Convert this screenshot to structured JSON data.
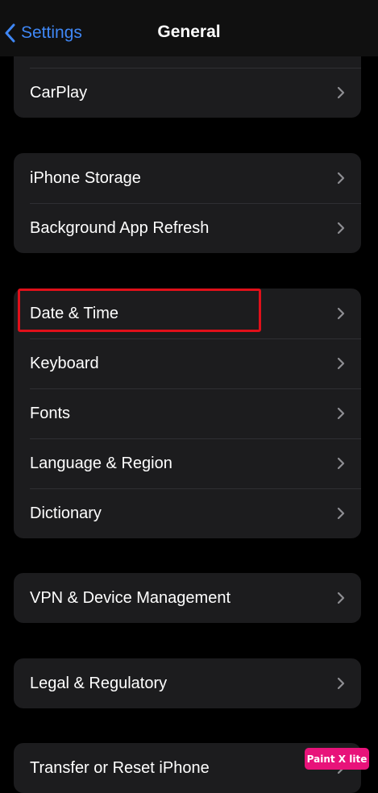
{
  "navbar": {
    "back_label": "Settings",
    "title": "General",
    "back_icon": "chevron-left-icon"
  },
  "groups": [
    {
      "items": [
        {
          "label": "CarPlay"
        }
      ]
    },
    {
      "items": [
        {
          "label": "iPhone Storage"
        },
        {
          "label": "Background App Refresh"
        }
      ]
    },
    {
      "items": [
        {
          "label": "Date & Time"
        },
        {
          "label": "Keyboard"
        },
        {
          "label": "Fonts"
        },
        {
          "label": "Language & Region"
        },
        {
          "label": "Dictionary"
        }
      ]
    },
    {
      "items": [
        {
          "label": "VPN & Device Management"
        }
      ]
    },
    {
      "items": [
        {
          "label": "Legal & Regulatory"
        }
      ]
    },
    {
      "items": [
        {
          "label": "Transfer or Reset iPhone"
        }
      ]
    }
  ],
  "row_icon": "chevron-right-icon",
  "watermark": "Paint X lite",
  "colors": {
    "background": "#000000",
    "group_background": "#1c1c1e",
    "accent": "#3f87f5",
    "highlight": "#e0101a",
    "chevron": "#8e8e93",
    "watermark": "#e8137a"
  }
}
